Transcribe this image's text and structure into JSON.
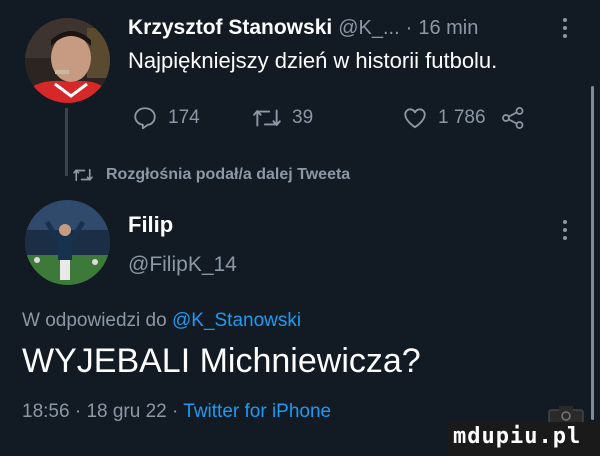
{
  "colors": {
    "background": "#121a24",
    "text_primary": "#ffffff",
    "text_secondary": "#8b98a5",
    "link": "#1d9bf0",
    "thread_line": "#38444d"
  },
  "tweet_parent": {
    "author_name": "Krzysztof Stanowski",
    "author_handle": "@K_...",
    "separator": "·",
    "time": "16 min",
    "text": "Najpiękniejszy dzień w historii futbolu.",
    "actions": {
      "reply": {
        "icon": "reply-icon",
        "count": "174"
      },
      "retweet": {
        "icon": "retweet-icon",
        "count": "39"
      },
      "like": {
        "icon": "heart-icon",
        "count": "1 786"
      },
      "share": {
        "icon": "share-icon"
      }
    }
  },
  "retweet_banner": {
    "icon": "retweet-icon",
    "text": "Rozgłośnia podał/a dalej Tweeta"
  },
  "tweet_main": {
    "author_name": "Filip",
    "author_handle": "@FilipK_14",
    "reply_prefix": "W odpowiedzi do",
    "reply_mention": "@K_Stanowski",
    "text": "WYJEBALI Michniewicza?",
    "meta_time": "18:56",
    "meta_sep1": "·",
    "meta_date": "18 gru 22",
    "meta_sep2": "·",
    "meta_source": "Twitter for iPhone"
  },
  "watermark": {
    "text": "mdupiu.pl"
  }
}
